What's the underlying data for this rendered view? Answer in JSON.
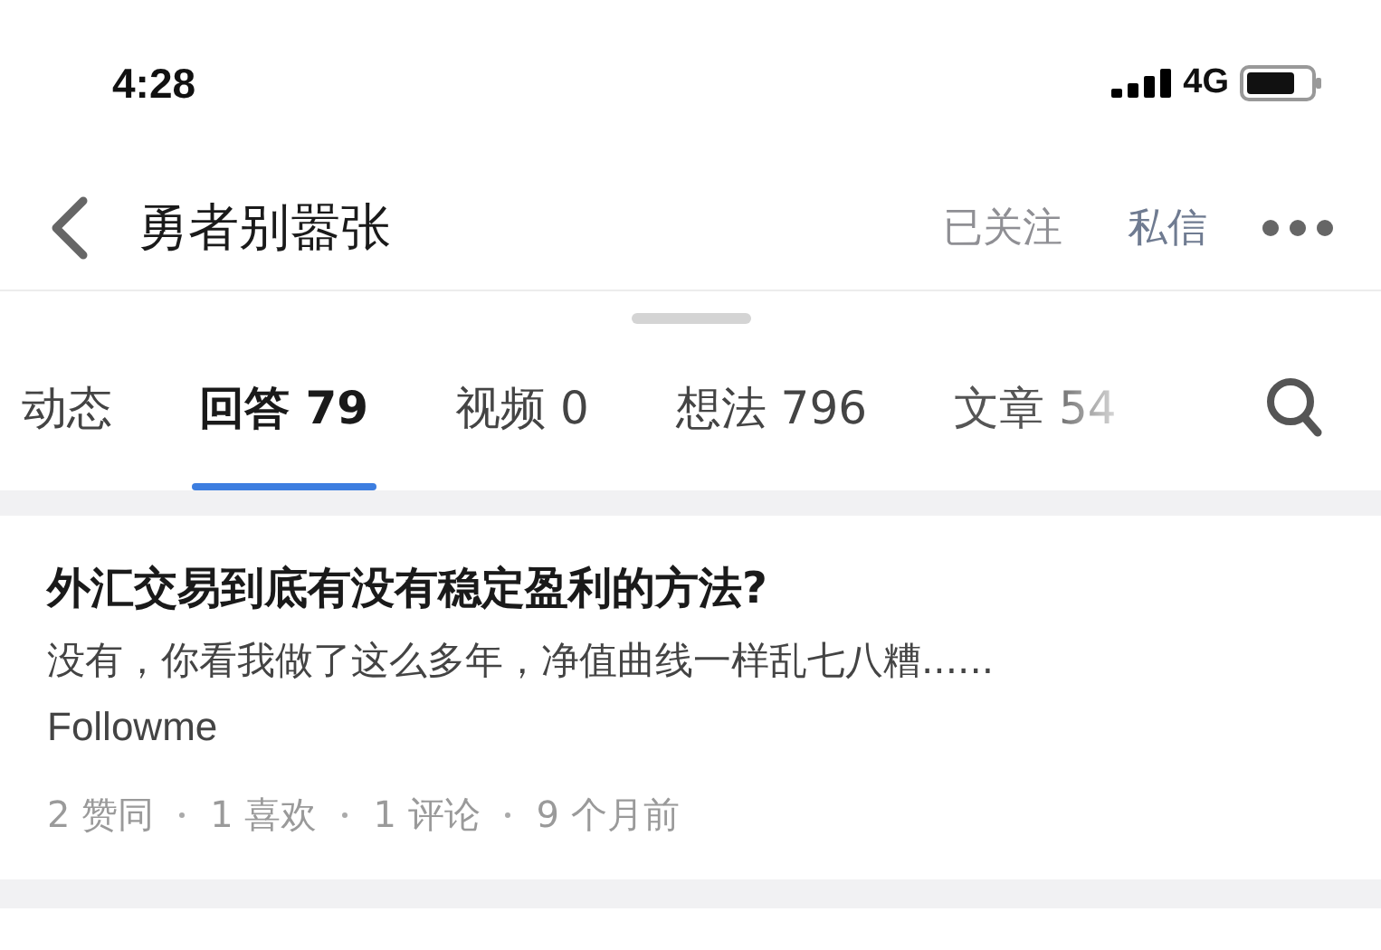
{
  "status_bar": {
    "time": "4:28",
    "network": "4G"
  },
  "header": {
    "title": "勇者别嚣张",
    "follow_button": "已关注",
    "message_button": "私信"
  },
  "tabs": [
    {
      "label": "动态",
      "selected": false
    },
    {
      "label": "回答 79",
      "selected": true
    },
    {
      "label": "视频 0",
      "selected": false
    },
    {
      "label": "想法 796",
      "selected": false
    },
    {
      "label": "文章 54",
      "selected": false
    }
  ],
  "answers": [
    {
      "question": "外汇交易到底有没有稳定盈利的方法?",
      "excerpt": "没有，你看我做了这么多年，净值曲线一样乱七八糟......",
      "author": "Followme",
      "meta": [
        "2 赞同",
        "1 喜欢",
        "1 评论",
        "9 个月前"
      ]
    }
  ]
}
